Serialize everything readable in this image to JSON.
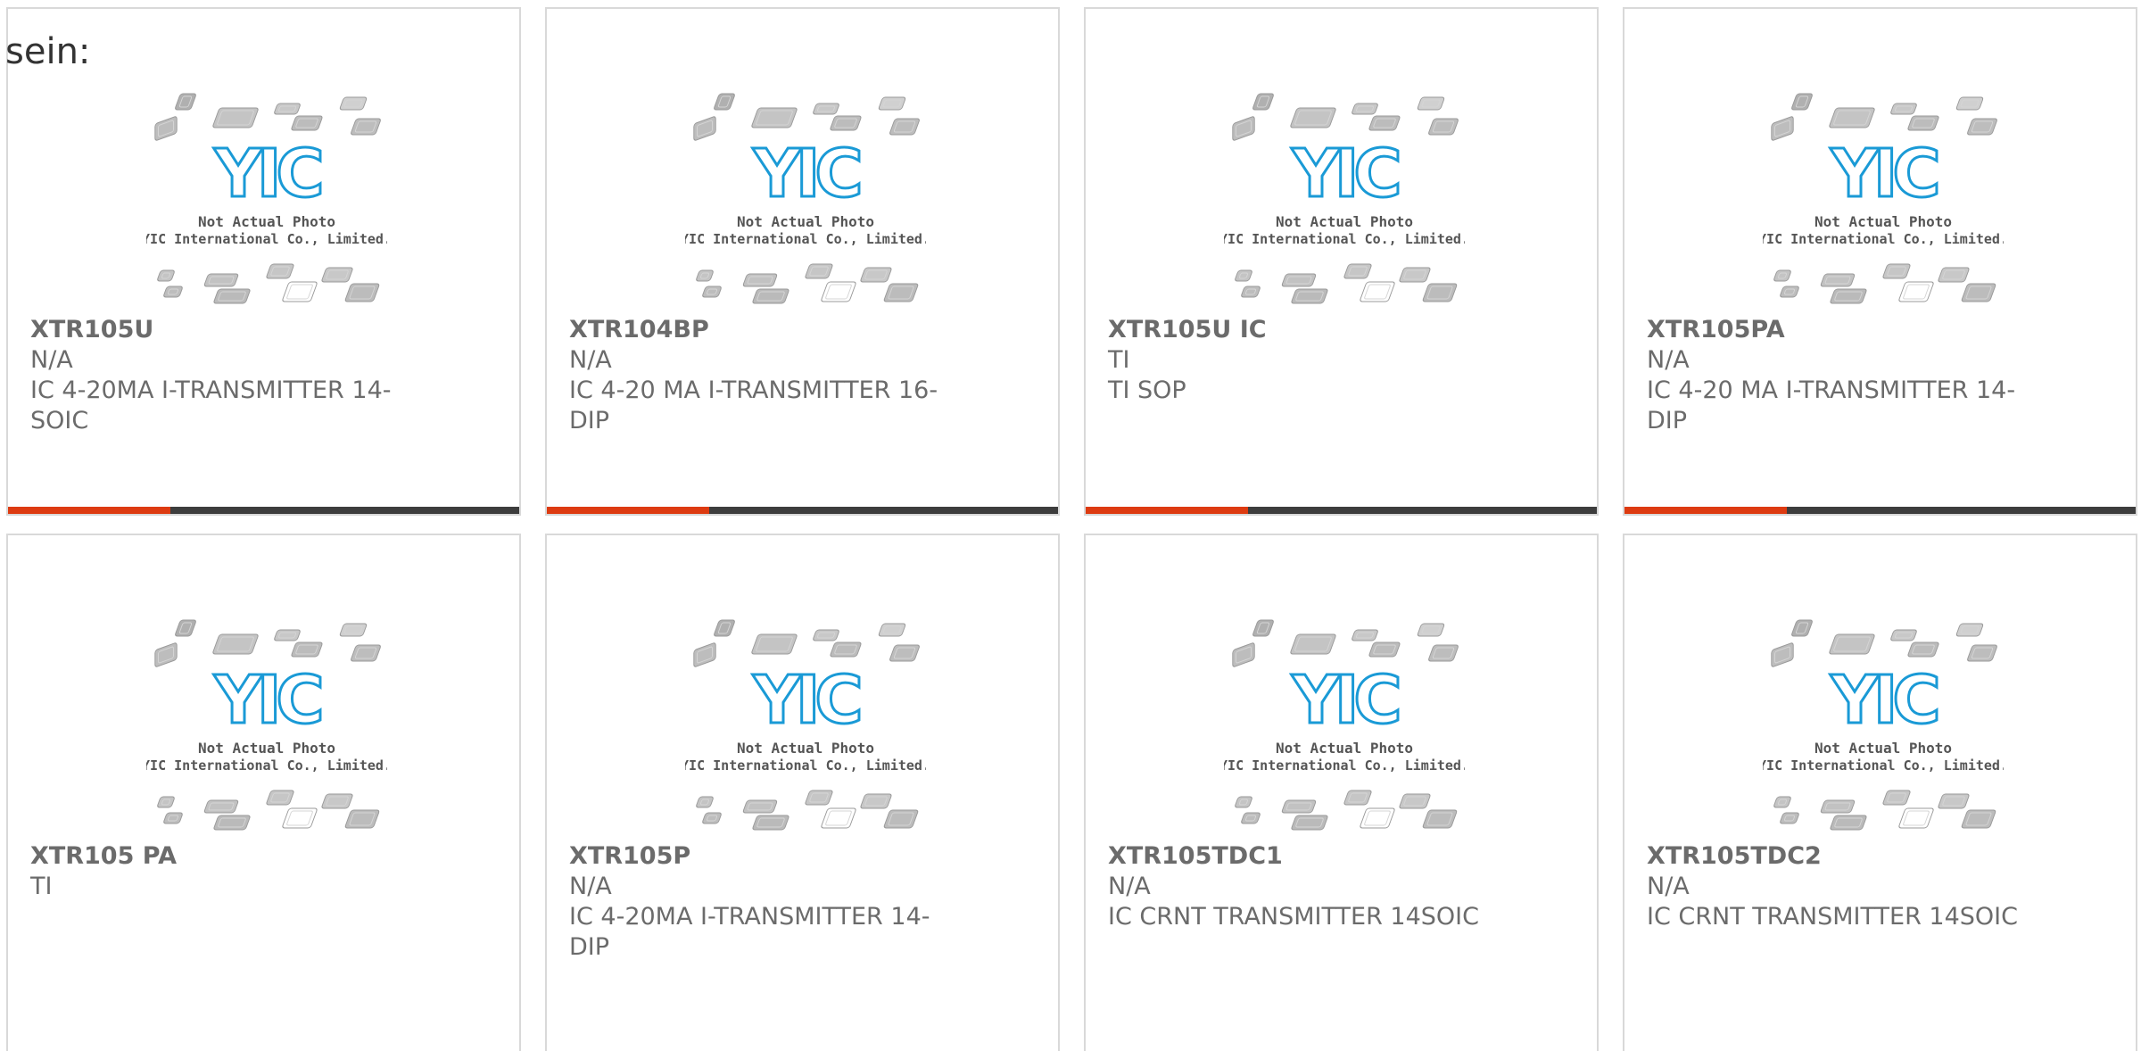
{
  "intro_text": "sein:",
  "placeholder": {
    "caption_line1": "Not Actual Photo",
    "caption_line2": "YIC International Co., Limited.",
    "logo_text": "YIC"
  },
  "colors": {
    "accent": "#dd3b11",
    "bar": "#3d3d3d",
    "logo": "#1a9ad6",
    "text": "#6b6b6b"
  },
  "products": [
    {
      "part": "XTR105U",
      "manufacturer": "N/A",
      "description_1": "IC 4-20MA I-TRANSMITTER 14-",
      "description_2": "SOIC"
    },
    {
      "part": "XTR104BP",
      "manufacturer": "N/A",
      "description_1": "IC 4-20 MA I-TRANSMITTER 16-",
      "description_2": "DIP"
    },
    {
      "part": "XTR105U IC",
      "manufacturer": "TI",
      "description_1": "TI SOP",
      "description_2": ""
    },
    {
      "part": "XTR105PA",
      "manufacturer": "N/A",
      "description_1": "IC 4-20 MA I-TRANSMITTER 14-",
      "description_2": "DIP"
    },
    {
      "part": "XTR105 PA",
      "manufacturer": "TI",
      "description_1": "",
      "description_2": ""
    },
    {
      "part": "XTR105P",
      "manufacturer": "N/A",
      "description_1": "IC 4-20MA I-TRANSMITTER 14-",
      "description_2": "DIP"
    },
    {
      "part": "XTR105TDC1",
      "manufacturer": "N/A",
      "description_1": "IC CRNT TRANSMITTER 14SOIC",
      "description_2": ""
    },
    {
      "part": "XTR105TDC2",
      "manufacturer": "N/A",
      "description_1": "IC CRNT TRANSMITTER 14SOIC",
      "description_2": ""
    }
  ]
}
